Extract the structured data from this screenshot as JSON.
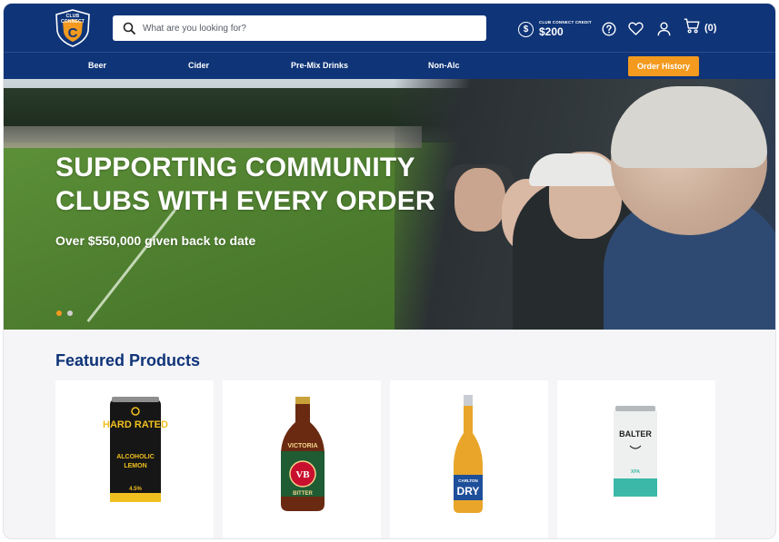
{
  "header": {
    "logo_text": "CLUB CONNECT",
    "search_placeholder": "What are you looking for?",
    "credit_label": "CLUB CONNECT CREDIT",
    "credit_amount": "$200",
    "cart_count": "(0)"
  },
  "nav": {
    "items": [
      "Beer",
      "Cider",
      "Pre-Mix Drinks",
      "Non-Alc"
    ],
    "order_history": "Order History"
  },
  "hero": {
    "title_line1": "SUPPORTING COMMUNITY",
    "title_line2": "CLUBS WITH EVERY ORDER",
    "subtitle": "Over $550,000 given back to date",
    "slides": 2,
    "active_slide": 0
  },
  "featured": {
    "title": "Featured Products",
    "products": [
      {
        "brand": "HARD RATED",
        "label_line1": "ALCOHOLIC",
        "label_line2": "LEMON",
        "abv": "4.5%"
      },
      {
        "brand": "VICTORIA",
        "badge": "VB",
        "label": "BITTER"
      },
      {
        "brand": "CARLTON",
        "label": "DRY"
      },
      {
        "brand": "BALTER",
        "label": "XPA"
      }
    ]
  },
  "colors": {
    "brand_navy": "#0f3478",
    "accent_orange": "#f39a1f",
    "page_bg": "#f5f5f8"
  }
}
